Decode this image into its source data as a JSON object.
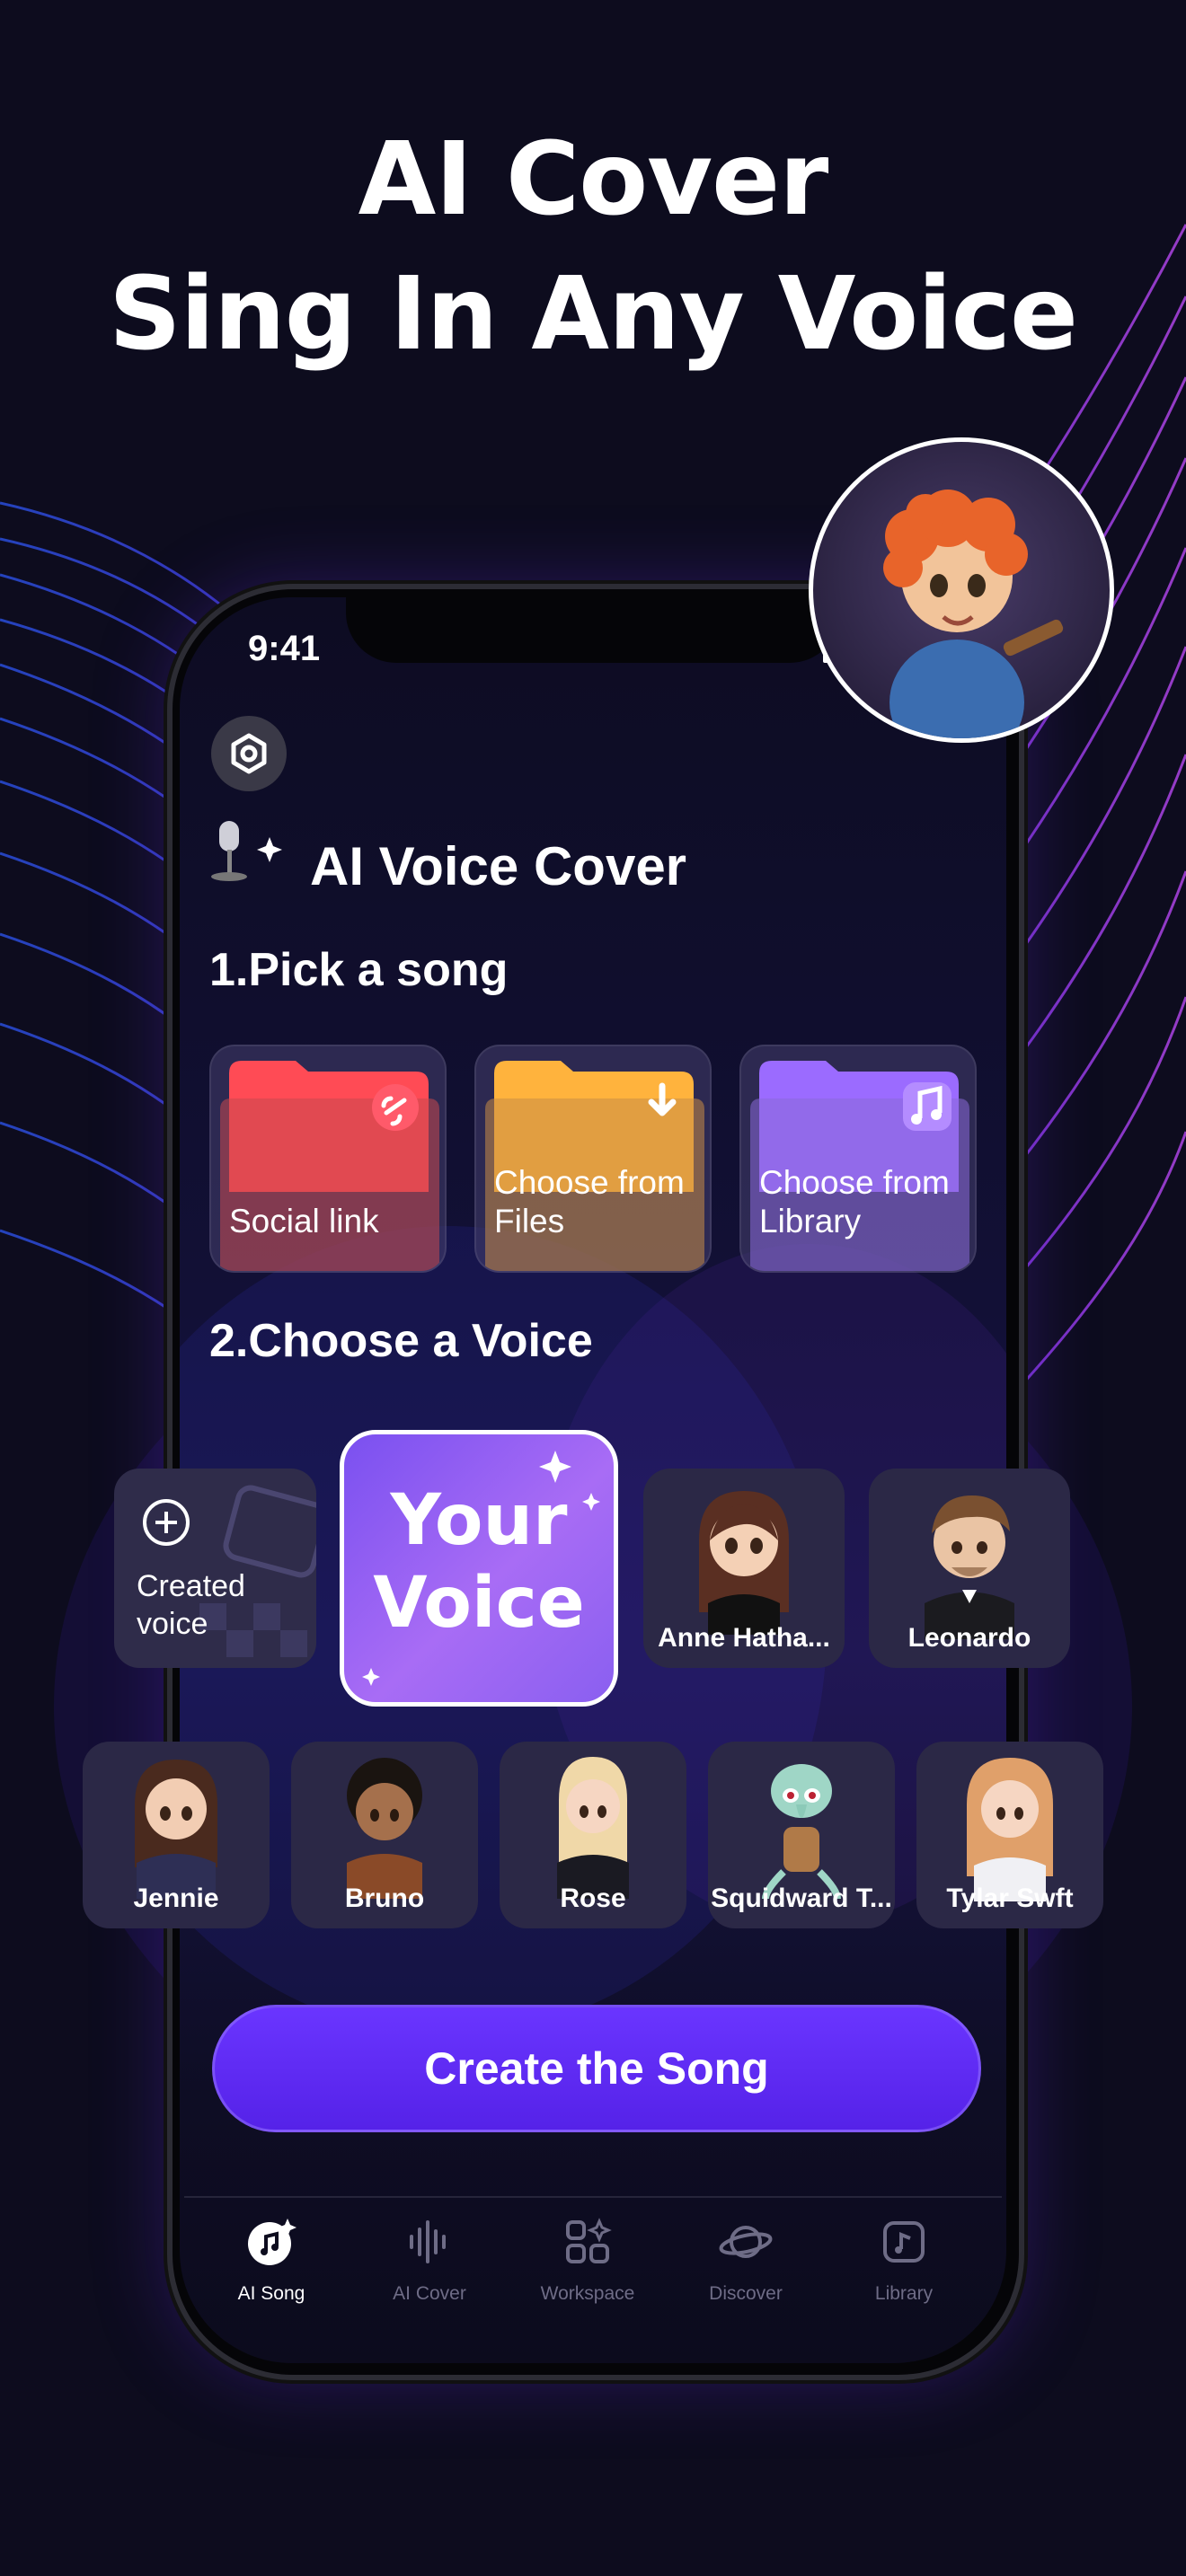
{
  "headline": {
    "line1": "AI Cover",
    "line2": "Sing In Any Voice"
  },
  "status_bar": {
    "time": "9:41"
  },
  "screen": {
    "title": "AI Voice Cover",
    "step1": "1.Pick a song",
    "step2": "2.Choose a Voice",
    "sources": [
      {
        "label": "Social link",
        "color": "#ff5a5a",
        "icon": "link-icon"
      },
      {
        "label": "Choose from Files",
        "color": "#ffb040",
        "icon": "download-icon"
      },
      {
        "label": "Choose from Library",
        "color": "#a070ff",
        "icon": "music-note-icon"
      }
    ],
    "created_voice": "Created voice",
    "your_voice": "Your Voice",
    "voices_row1": [
      "Anne Hatha...",
      "Leonardo"
    ],
    "voices_row2": [
      "Jennie",
      "Bruno",
      "Rose",
      "Squidward T...",
      "Tylar Swft"
    ],
    "cta": "Create the Song"
  },
  "tabs": [
    {
      "label": "AI Song",
      "icon": "music-disc-icon",
      "active": true
    },
    {
      "label": "AI Cover",
      "icon": "waveform-icon",
      "active": false
    },
    {
      "label": "Workspace",
      "icon": "grid-icon",
      "active": false
    },
    {
      "label": "Discover",
      "icon": "planet-icon",
      "active": false
    },
    {
      "label": "Library",
      "icon": "library-icon",
      "active": false
    }
  ],
  "colors": {
    "accent": "#5a25f0",
    "background": "#0d0c1e"
  }
}
